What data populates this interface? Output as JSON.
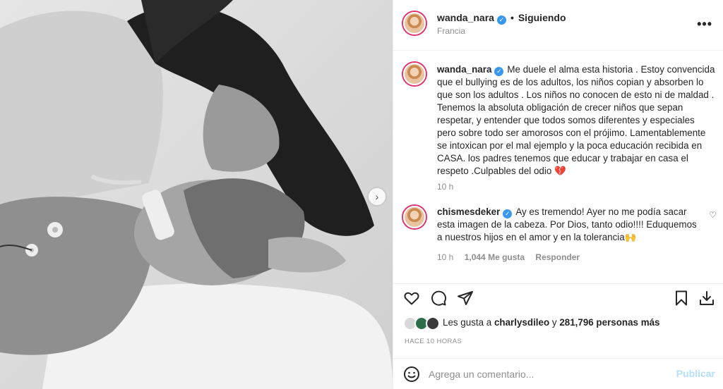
{
  "post": {
    "username": "wanda_nara",
    "follow_status": "Siguiendo",
    "location": "Francia",
    "more_label": "•••"
  },
  "comments": [
    {
      "username": "wanda_nara",
      "text": "Me duele el alma esta historia . Estoy convencida que el bullying es de los adultos, los niños copian y absorben lo que son los adultos . Los niños no conocen de esto ni de maldad . Tenemos la absoluta obligación de crecer niños que sepan respetar, y entender que todos somos diferentes y especiales pero sobre todo ser amorosos con el prójimo. Lamentablemente se intoxican por el mal ejemplo y la poca educación recibida en CASA. los padres tenemos que educar y trabajar en casa el respeto .Culpables del odio 💔",
      "time": "10 h"
    },
    {
      "username": "chismesdeker",
      "text": "Ay es tremendo! Ayer no me podía sacar esta imagen de la cabeza. Por Dios, tanto odio!!!! Eduquemos a nuestros hijos en el amor y en la tolerancia🙌",
      "time": "10 h",
      "likes": "1,044 Me gusta",
      "reply": "Responder"
    }
  ],
  "likes": {
    "prefix": "Les gusta a",
    "user": "charlysdileo",
    "connector": "y",
    "others": "281,796 personas más"
  },
  "timestamp": "HACE 10 HORAS",
  "composer": {
    "placeholder": "Agrega un comentario...",
    "publish_label": "Publicar"
  },
  "icons": {
    "verified": "verified-badge-icon",
    "like": "heart-icon",
    "comment": "comment-icon",
    "share": "share-icon",
    "save": "bookmark-icon",
    "download": "download-icon",
    "emoji": "emoji-icon",
    "next": "chevron-right-icon"
  },
  "colors": {
    "verified": "#3897f0",
    "publish_disabled": "#b2dffc",
    "secondary_text": "#8e8e8e",
    "broken_heart": "#d0243c"
  }
}
